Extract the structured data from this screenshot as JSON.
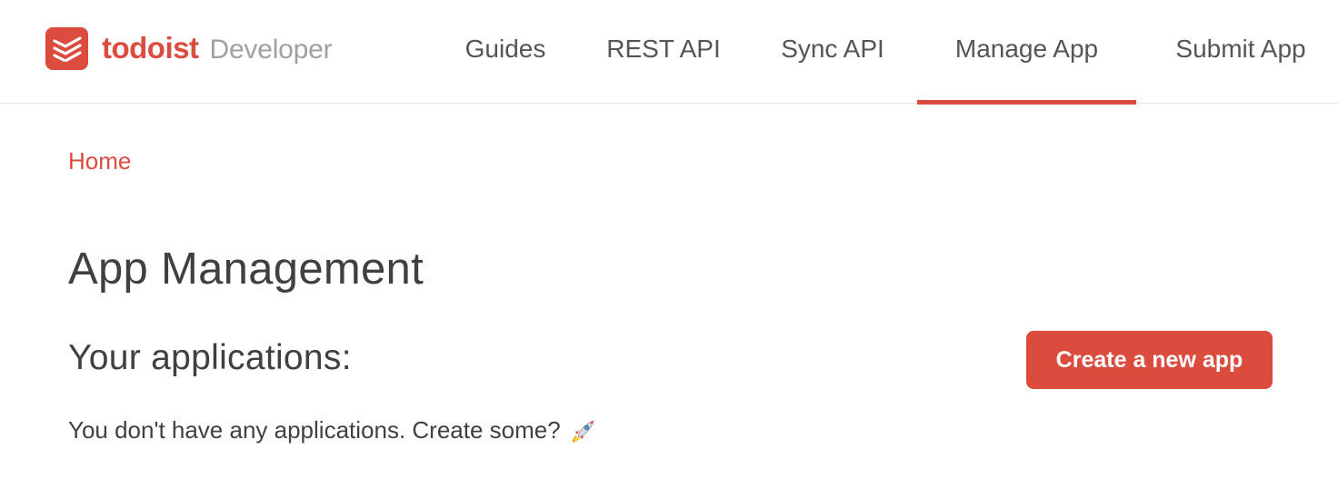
{
  "brand": {
    "name": "todoist",
    "subtitle": "Developer"
  },
  "nav": {
    "items": [
      {
        "label": "Guides",
        "active": false
      },
      {
        "label": "REST API",
        "active": false
      },
      {
        "label": "Sync API",
        "active": false
      },
      {
        "label": "Manage App",
        "active": true
      },
      {
        "label": "Submit App",
        "active": false
      }
    ]
  },
  "breadcrumb": {
    "home_label": "Home"
  },
  "main": {
    "page_title": "App Management",
    "section_title": "Your applications:",
    "create_button_label": "Create a new app",
    "empty_message": "You don't have any applications. Create some?",
    "empty_icon": "rocket-icon"
  },
  "colors": {
    "accent": "#db4c3f",
    "text": "#404040",
    "muted": "#a0a0a0"
  }
}
